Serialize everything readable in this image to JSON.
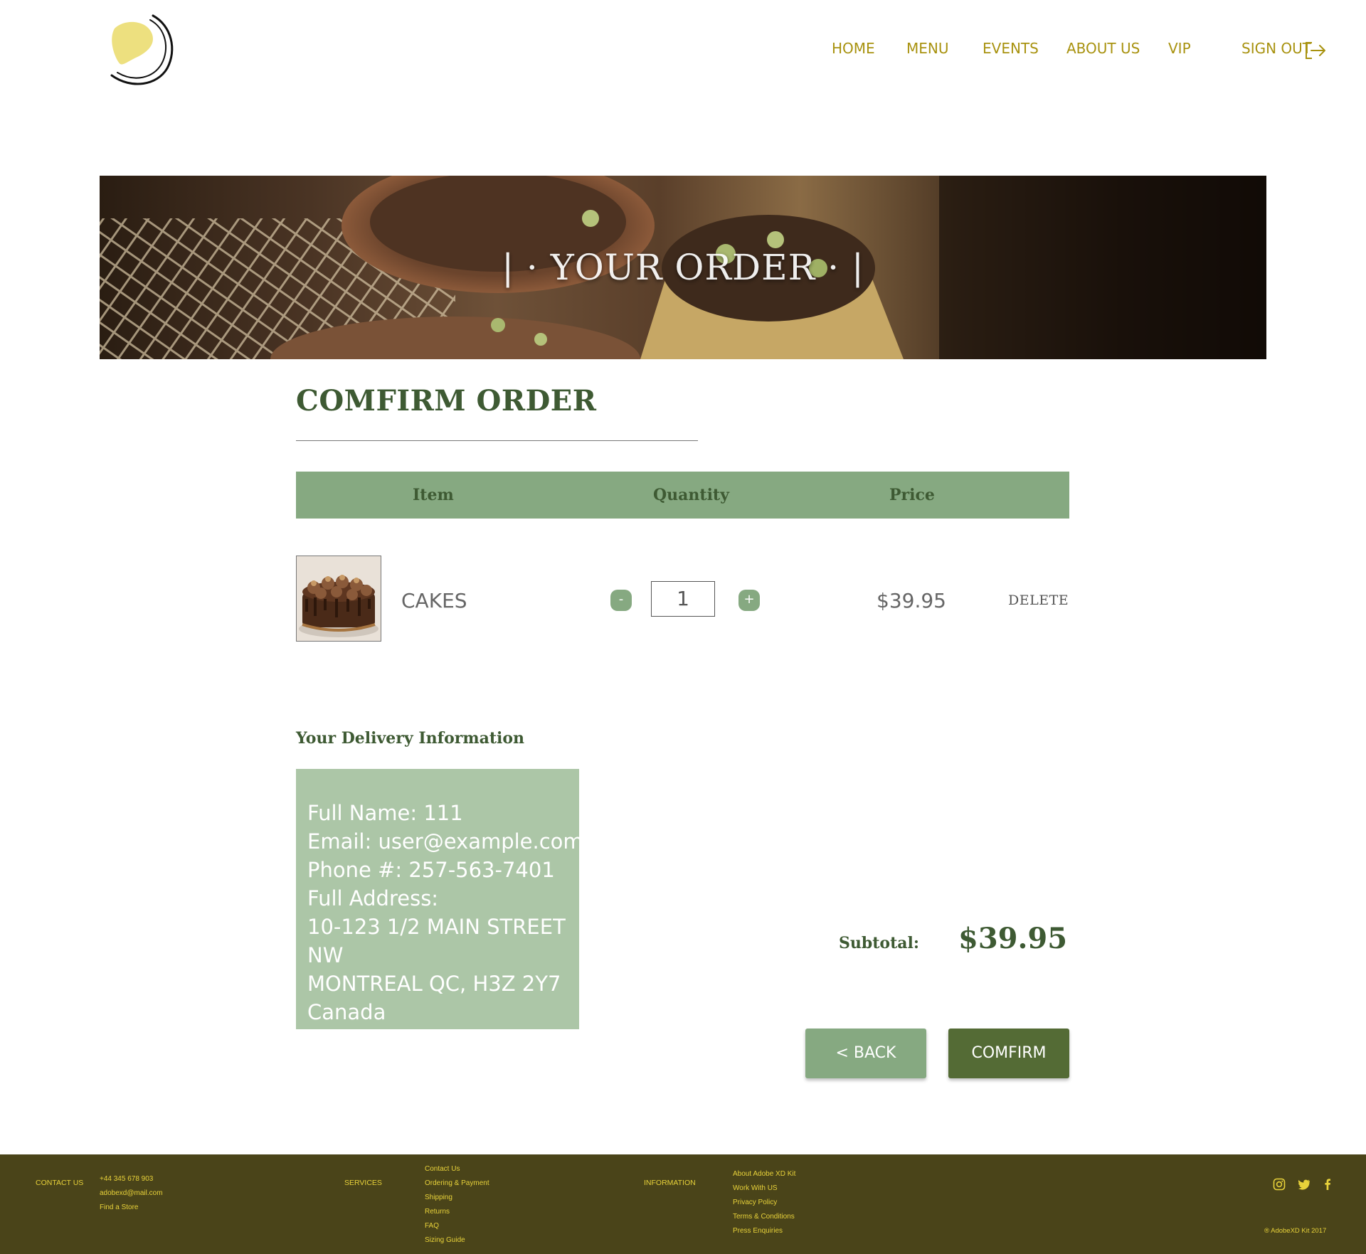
{
  "nav": {
    "items": [
      "HOME",
      "MENU",
      "EVENTS",
      "ABOUT US",
      "VIP"
    ],
    "sign_out": "SIGN OUT",
    "logo_icon": "crescent-moon-logo",
    "sign_out_icon": "sign-out-icon"
  },
  "hero": {
    "title": "| · YOUR ORDER · |"
  },
  "confirm": {
    "title": "COMFIRM ORDER",
    "table": {
      "headers": [
        "Item",
        "Quantity",
        "Price"
      ]
    },
    "item": {
      "name": "CAKES",
      "quantity": "1",
      "price": "$39.95",
      "delete_label": "DELETE",
      "minus": "-",
      "plus": "+"
    },
    "delivery": {
      "title": "Your Delivery Information",
      "lines": [
        "Full Name: 111",
        "Email: user@example.com",
        "Phone #: 257-563-7401",
        "Full Address:",
        "10-123 1/2 MAIN STREET",
        "NW",
        "MONTREAL QC, H3Z 2Y7",
        "Canada"
      ]
    },
    "subtotal": {
      "label": "Subtotal:",
      "value": "$39.95"
    },
    "buttons": {
      "back": "< BACK",
      "confirm": "COMFIRM"
    }
  },
  "footer": {
    "contact": {
      "heading": "CONTACT US",
      "items": [
        "+44 345 678 903",
        "adobexd@mail.com",
        "Find a Store"
      ]
    },
    "services": {
      "heading": "SERVICES",
      "items": [
        "Contact Us",
        "Ordering & Payment",
        "Shipping",
        "Returns",
        "FAQ",
        "Sizing Guide"
      ]
    },
    "information": {
      "heading": "INFORMATION",
      "items": [
        "About Adobe XD Kit",
        "Work With US",
        "Privacy Policy",
        "Terms & Conditions",
        "Press Enquiries"
      ]
    },
    "social_icons": [
      "instagram-icon",
      "twitter-icon",
      "facebook-icon"
    ],
    "copyright": "® AdobeXD Kit 2017"
  },
  "colors": {
    "accent_gold": "#a8920f",
    "dark_green": "#3e5a33",
    "table_green": "#86a981",
    "delivery_green": "#acc6a7",
    "confirm_button": "#546b35",
    "footer_bg": "#4a4419",
    "footer_text": "#e8d23a"
  }
}
